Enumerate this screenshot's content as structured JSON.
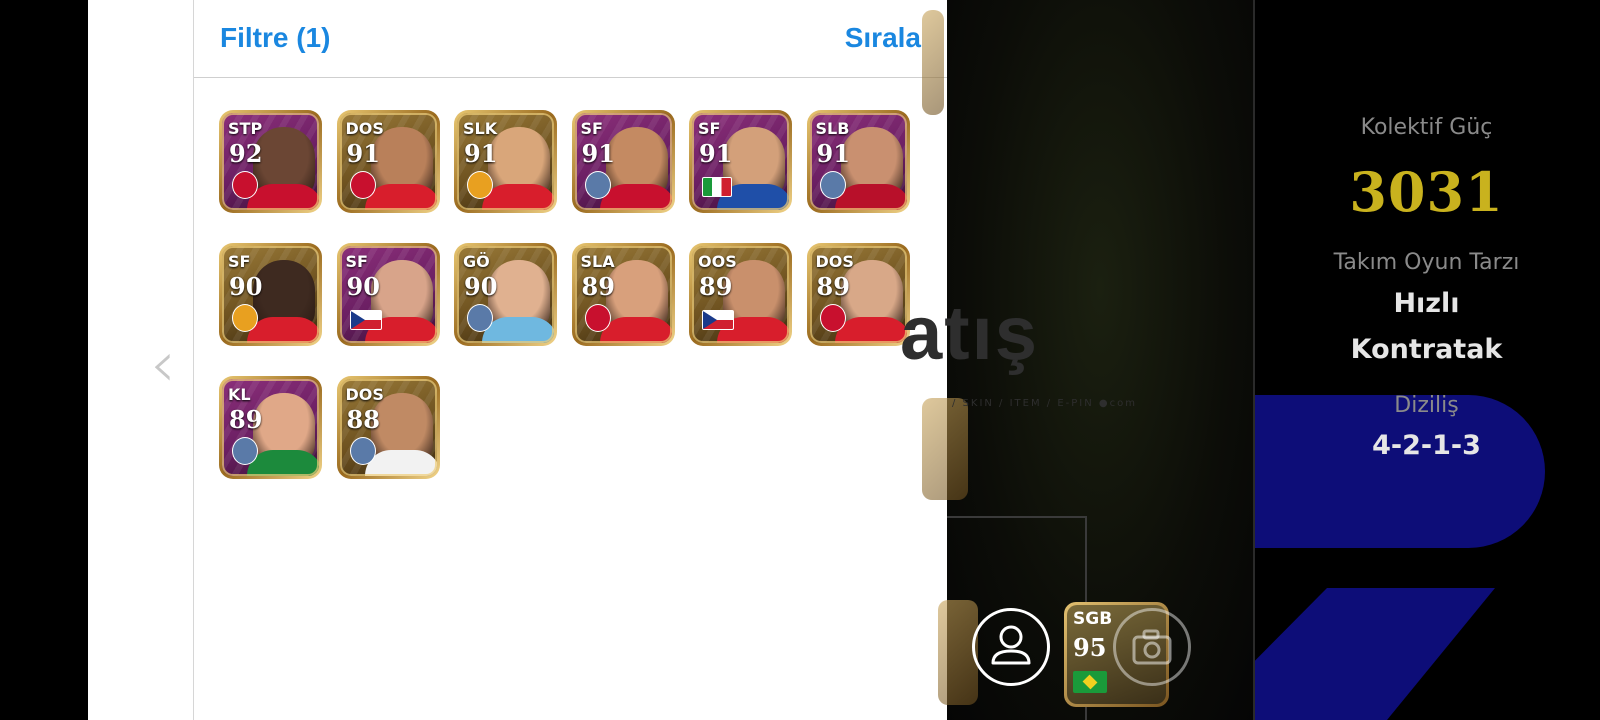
{
  "panel": {
    "filter_label": "Filtre (1)",
    "sort_label": "Sırala"
  },
  "players": [
    {
      "position": "STP",
      "rating": "92",
      "badge": "arsenal-crest-icon",
      "bg": "purple",
      "skin": "#6b4634",
      "shirt": "#c8102e"
    },
    {
      "position": "DOS",
      "rating": "91",
      "badge": "arsenal-crest-icon",
      "bg": "gold",
      "skin": "#b9805a",
      "shirt": "#d81e2c"
    },
    {
      "position": "SLK",
      "rating": "91",
      "badge": "man-utd-crest-icon",
      "bg": "gold",
      "skin": "#d9a67a",
      "shirt": "#d81e2c"
    },
    {
      "position": "SF",
      "rating": "91",
      "badge": "club-crest-icon",
      "bg": "purple",
      "skin": "#c48a62",
      "shirt": "#c8102e"
    },
    {
      "position": "SF",
      "rating": "91",
      "badge": "italy-flag-icon",
      "bg": "purple",
      "skin": "#d3a07a",
      "shirt": "#1f4fa8"
    },
    {
      "position": "SLB",
      "rating": "91",
      "badge": "club-crest-icon",
      "bg": "purple",
      "skin": "#c99070",
      "shirt": "#b8102a"
    },
    {
      "position": "SF",
      "rating": "90",
      "badge": "man-utd-crest-icon",
      "bg": "gold",
      "skin": "#3e2a20",
      "shirt": "#d81e2c"
    },
    {
      "position": "SF",
      "rating": "90",
      "badge": "czech-flag-icon",
      "bg": "purple",
      "skin": "#d8a48a",
      "shirt": "#d81e2c"
    },
    {
      "position": "GÖ",
      "rating": "90",
      "badge": "club-crest-icon",
      "bg": "gold",
      "skin": "#e0b190",
      "shirt": "#6fb8e0"
    },
    {
      "position": "SLA",
      "rating": "89",
      "badge": "arsenal-crest-icon",
      "bg": "gold",
      "skin": "#d8a07c",
      "shirt": "#d81e2c"
    },
    {
      "position": "OOS",
      "rating": "89",
      "badge": "czech-flag-icon",
      "bg": "gold",
      "skin": "#c9906c",
      "shirt": "#d81e2c"
    },
    {
      "position": "DOS",
      "rating": "89",
      "badge": "arsenal-crest-icon",
      "bg": "gold",
      "skin": "#d8a888",
      "shirt": "#d81e2c"
    },
    {
      "position": "KL",
      "rating": "89",
      "badge": "club-crest-icon",
      "bg": "purple",
      "skin": "#e0a888",
      "shirt": "#1c8a3c"
    },
    {
      "position": "DOS",
      "rating": "88",
      "badge": "club-crest-icon",
      "bg": "gold",
      "skin": "#c08a64",
      "shirt": "#f2f2f2"
    }
  ],
  "pitch": {
    "watermark": "atış",
    "watermark_sub": "/ SKIN / ITEM / E-PIN ●com",
    "sgb_card": {
      "position": "SGB",
      "rating": "95",
      "badge": "brazil-flag-icon"
    }
  },
  "team_info": {
    "power_label": "Kolektif Güç",
    "power_value": "3031",
    "style_label": "Takım Oyun Tarzı",
    "style_value_1": "Hızlı",
    "style_value_2": "Kontratak",
    "formation_label": "Diziliş",
    "formation_value": "4-2-1-3"
  },
  "colors": {
    "accent": "#1a87e0",
    "power": "#c9b21e",
    "info_blue": "#0d0d78"
  }
}
